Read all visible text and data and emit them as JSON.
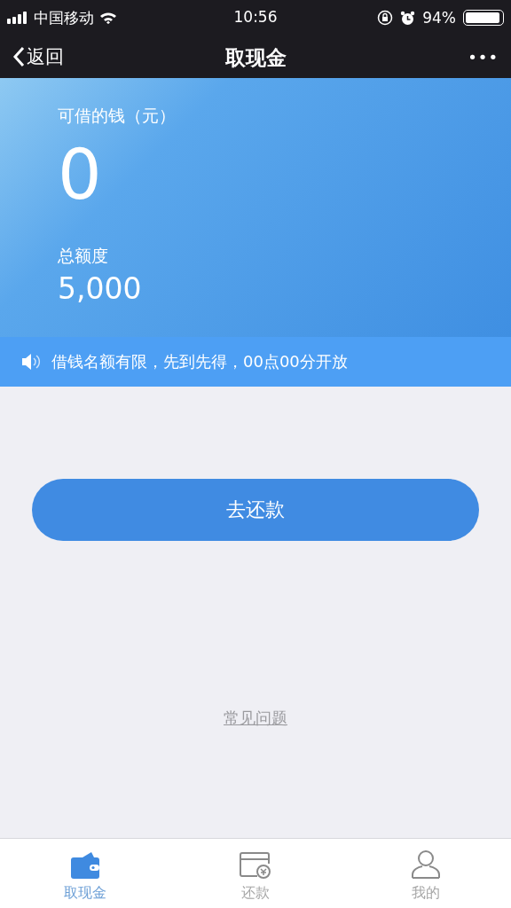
{
  "status_bar": {
    "carrier": "中国移动",
    "time": "10:56",
    "battery": "94%"
  },
  "nav": {
    "back": "返回",
    "title": "取现金",
    "more": "•••"
  },
  "balance": {
    "label": "可借的钱（元）",
    "amount": "0",
    "limit_label": "总额度",
    "limit": "5,000"
  },
  "notice": "借钱名额有限，先到先得，00点00分开放",
  "repay_button": "去还款",
  "faq_link": "常见问题",
  "tabs": [
    {
      "label": "取现金",
      "kind": "wallet",
      "selected": true
    },
    {
      "label": "还款",
      "kind": "card",
      "selected": false
    },
    {
      "label": "我的",
      "kind": "person",
      "selected": false
    }
  ]
}
